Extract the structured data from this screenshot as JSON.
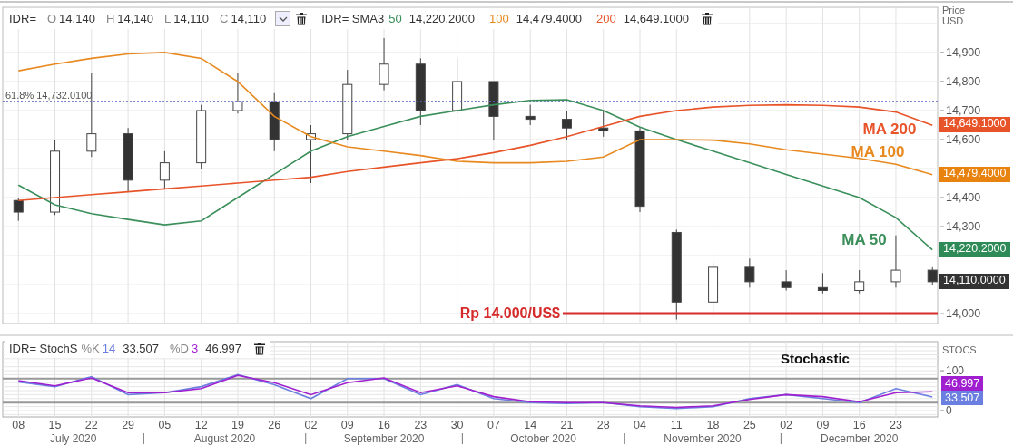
{
  "price_panel": {
    "legend": {
      "symbol": "IDR=",
      "fields": [
        {
          "label": "O",
          "value": "14,140"
        },
        {
          "label": "H",
          "value": "14,140"
        },
        {
          "label": "L",
          "value": "14,110"
        },
        {
          "label": "C",
          "value": "14,110"
        }
      ]
    },
    "sma_legend": {
      "name": "IDR= SMA3",
      "items": [
        {
          "period": "50",
          "value": "14,220.2000",
          "color": "#3a8f5a"
        },
        {
          "period": "100",
          "value": "14,479.4000",
          "color": "#e8891f"
        },
        {
          "period": "200",
          "value": "14,649.1000",
          "color": "#e8542a"
        }
      ]
    },
    "axis_title": [
      "Price",
      "USD"
    ],
    "candles": {
      "chart_data": {
        "type": "candlestick",
        "grid": true,
        "x": [
          "2020-07-08",
          "2020-07-15",
          "2020-07-22",
          "2020-07-29",
          "2020-08-05",
          "2020-08-12",
          "2020-08-19",
          "2020-08-26",
          "2020-09-02",
          "2020-09-09",
          "2020-09-16",
          "2020-09-23",
          "2020-09-30",
          "2020-10-07",
          "2020-10-14",
          "2020-10-21",
          "2020-10-28",
          "2020-11-04",
          "2020-11-11",
          "2020-11-18",
          "2020-11-25",
          "2020-12-02",
          "2020-12-09",
          "2020-12-16",
          "2020-12-23",
          "2020-12-30"
        ],
        "xlim": [
          "2020-07-05",
          "2020-12-31"
        ],
        "ohlc": [
          [
            14390,
            14400,
            14320,
            14350
          ],
          [
            14350,
            14600,
            14340,
            14560
          ],
          [
            14560,
            14830,
            14540,
            14620
          ],
          [
            14620,
            14640,
            14420,
            14460
          ],
          [
            14460,
            14560,
            14430,
            14520
          ],
          [
            14520,
            14720,
            14500,
            14700
          ],
          [
            14700,
            14830,
            14690,
            14730
          ],
          [
            14730,
            14760,
            14560,
            14600
          ],
          [
            14600,
            14650,
            14450,
            14620
          ],
          [
            14620,
            14840,
            14600,
            14790
          ],
          [
            14790,
            14950,
            14770,
            14860
          ],
          [
            14860,
            14880,
            14650,
            14700
          ],
          [
            14700,
            14880,
            14690,
            14800
          ],
          [
            14800,
            14800,
            14600,
            14680
          ],
          [
            14680,
            14720,
            14650,
            14670
          ],
          [
            14670,
            14700,
            14600,
            14640
          ],
          [
            14640,
            14700,
            14610,
            14630
          ],
          [
            14630,
            14640,
            14350,
            14370
          ],
          [
            14280,
            14290,
            13980,
            14040
          ],
          [
            14040,
            14180,
            13990,
            14160
          ],
          [
            14160,
            14190,
            14090,
            14110
          ],
          [
            14110,
            14150,
            14080,
            14090
          ],
          [
            14090,
            14140,
            14070,
            14080
          ],
          [
            14080,
            14150,
            14070,
            14110
          ],
          [
            14110,
            14270,
            14090,
            14150
          ],
          [
            14150,
            14160,
            14100,
            14110
          ]
        ],
        "ylim": [
          13966,
          15056
        ]
      }
    },
    "moving_averages": {
      "chart_data": {
        "type": "line",
        "x": [
          "2020-07-08",
          "2020-07-15",
          "2020-07-22",
          "2020-07-29",
          "2020-08-05",
          "2020-08-12",
          "2020-08-19",
          "2020-08-26",
          "2020-09-02",
          "2020-09-09",
          "2020-09-16",
          "2020-09-23",
          "2020-09-30",
          "2020-10-07",
          "2020-10-14",
          "2020-10-21",
          "2020-10-28",
          "2020-11-04",
          "2020-11-11",
          "2020-11-18",
          "2020-11-25",
          "2020-12-02",
          "2020-12-09",
          "2020-12-16",
          "2020-12-23",
          "2020-12-30"
        ],
        "xlim": [
          "2020-07-05",
          "2020-12-31"
        ],
        "series": [
          {
            "name": "MA 50",
            "color": "#3a8f5a",
            "values": [
              14443,
              14375,
              14345,
              14325,
              14306,
              14320,
              14400,
              14480,
              14560,
              14610,
              14645,
              14680,
              14700,
              14720,
              14735,
              14737,
              14700,
              14643,
              14600,
              14560,
              14520,
              14480,
              14440,
              14400,
              14331,
              14220
            ]
          },
          {
            "name": "MA 100",
            "color": "#e8891f",
            "values": [
              14837,
              14860,
              14880,
              14895,
              14900,
              14880,
              14800,
              14680,
              14610,
              14575,
              14560,
              14545,
              14525,
              14520,
              14520,
              14525,
              14540,
              14600,
              14600,
              14598,
              14585,
              14565,
              14550,
              14535,
              14515,
              14479
            ]
          },
          {
            "name": "MA 200",
            "color": "#e8542a",
            "values": [
              14390,
              14400,
              14410,
              14420,
              14430,
              14440,
              14450,
              14460,
              14470,
              14490,
              14505,
              14520,
              14534,
              14555,
              14580,
              14610,
              14645,
              14680,
              14700,
              14712,
              14718,
              14720,
              14718,
              14712,
              14695,
              14649
            ]
          }
        ],
        "ylim": [
          13966,
          15056
        ],
        "yticks": [
          {
            "value": 14000,
            "label": "14,000"
          },
          {
            "value": 14300,
            "label": "14,300"
          },
          {
            "value": 14400,
            "label": "14,400"
          },
          {
            "value": 14600,
            "label": "14,600"
          },
          {
            "value": 14700,
            "label": "14,700"
          },
          {
            "value": 14800,
            "label": "14,800"
          },
          {
            "value": 14900,
            "label": "14,900"
          }
        ],
        "ref_lines": [
          {
            "axis": "y",
            "value": 14732.01,
            "label": "61.8% 14,732.0100",
            "color": "#5560c0"
          },
          {
            "axis": "y",
            "value": 14000,
            "label": "Rp 14.000/US$",
            "color": "#d62b2b"
          }
        ]
      }
    },
    "value_tags": [
      {
        "text": "14,649.1000",
        "color": "#e8542a"
      },
      {
        "text": "14,479.4000",
        "color": "#e8830f"
      },
      {
        "text": "14,220.2000",
        "color": "#2e8b57"
      },
      {
        "text": "14,110.0000",
        "color": "#333333"
      }
    ]
  },
  "stochastic_panel": {
    "legend": {
      "name": "IDR= StochS",
      "k_period": "14",
      "k_value": "33.507",
      "d_period": "3",
      "d_value": "46.997"
    },
    "axis_title": "STOCS",
    "chart_data": {
      "type": "line",
      "title": "Stochastic",
      "grid": true,
      "x": [
        "2020-07-08",
        "2020-07-15",
        "2020-07-22",
        "2020-07-29",
        "2020-08-05",
        "2020-08-12",
        "2020-08-19",
        "2020-08-26",
        "2020-09-02",
        "2020-09-09",
        "2020-09-16",
        "2020-09-23",
        "2020-09-30",
        "2020-10-07",
        "2020-10-14",
        "2020-10-21",
        "2020-10-28",
        "2020-11-04",
        "2020-11-11",
        "2020-11-18",
        "2020-11-25",
        "2020-12-02",
        "2020-12-09",
        "2020-12-16",
        "2020-12-23",
        "2020-12-30"
      ],
      "xlim": [
        "2020-07-05",
        "2020-12-31"
      ],
      "series": [
        {
          "name": "%K",
          "color": "#6b7fe0",
          "values": [
            72,
            60,
            85,
            40,
            45,
            60,
            90,
            65,
            30,
            80,
            80,
            40,
            65,
            30,
            20,
            18,
            20,
            10,
            5,
            10,
            30,
            40,
            30,
            20,
            55,
            34
          ]
        },
        {
          "name": "%D",
          "color": "#a020d0",
          "values": [
            75,
            62,
            82,
            45,
            45,
            55,
            88,
            70,
            40,
            70,
            82,
            45,
            62,
            35,
            22,
            20,
            20,
            12,
            8,
            12,
            28,
            40,
            35,
            22,
            45,
            47
          ]
        }
      ],
      "ylim": [
        -16,
        173
      ],
      "yticks": [
        {
          "value": 0,
          "label": "0"
        },
        {
          "value": 100,
          "label": "100"
        }
      ],
      "xticks": [
        {
          "value": "2020-07-08",
          "label": "08"
        },
        {
          "value": "2020-07-15",
          "label": "15"
        },
        {
          "value": "2020-07-22",
          "label": "22"
        },
        {
          "value": "2020-07-29",
          "label": "29"
        },
        {
          "value": "2020-08-05",
          "label": "05"
        },
        {
          "value": "2020-08-12",
          "label": "12"
        },
        {
          "value": "2020-08-19",
          "label": "19"
        },
        {
          "value": "2020-08-26",
          "label": "26"
        },
        {
          "value": "2020-09-02",
          "label": "02"
        },
        {
          "value": "2020-09-09",
          "label": "09"
        },
        {
          "value": "2020-09-16",
          "label": "16"
        },
        {
          "value": "2020-09-23",
          "label": "23"
        },
        {
          "value": "2020-09-30",
          "label": "30"
        },
        {
          "value": "2020-10-07",
          "label": "07"
        },
        {
          "value": "2020-10-14",
          "label": "14"
        },
        {
          "value": "2020-10-21",
          "label": "21"
        },
        {
          "value": "2020-10-28",
          "label": "28"
        },
        {
          "value": "2020-11-04",
          "label": "04"
        },
        {
          "value": "2020-11-11",
          "label": "11"
        },
        {
          "value": "2020-11-18",
          "label": "18"
        },
        {
          "value": "2020-11-25",
          "label": "25"
        },
        {
          "value": "2020-12-02",
          "label": "02"
        },
        {
          "value": "2020-12-09",
          "label": "09"
        },
        {
          "value": "2020-12-16",
          "label": "16"
        },
        {
          "value": "2020-12-23",
          "label": "23"
        }
      ],
      "ref_lines": [
        {
          "axis": "y",
          "value": 80,
          "color": "#999999"
        },
        {
          "axis": "y",
          "value": 20,
          "color": "#999999"
        }
      ]
    },
    "value_tags": [
      {
        "text": "46.997",
        "color": "#a020d0"
      },
      {
        "text": "33.507",
        "color": "#6b7fe0"
      }
    ]
  },
  "time_axis": {
    "months": [
      {
        "label": "July 2020"
      },
      {
        "label": "August 2020"
      },
      {
        "label": "September 2020"
      },
      {
        "label": "October 2020"
      },
      {
        "label": "November 2020"
      },
      {
        "label": "December 2020"
      }
    ]
  }
}
